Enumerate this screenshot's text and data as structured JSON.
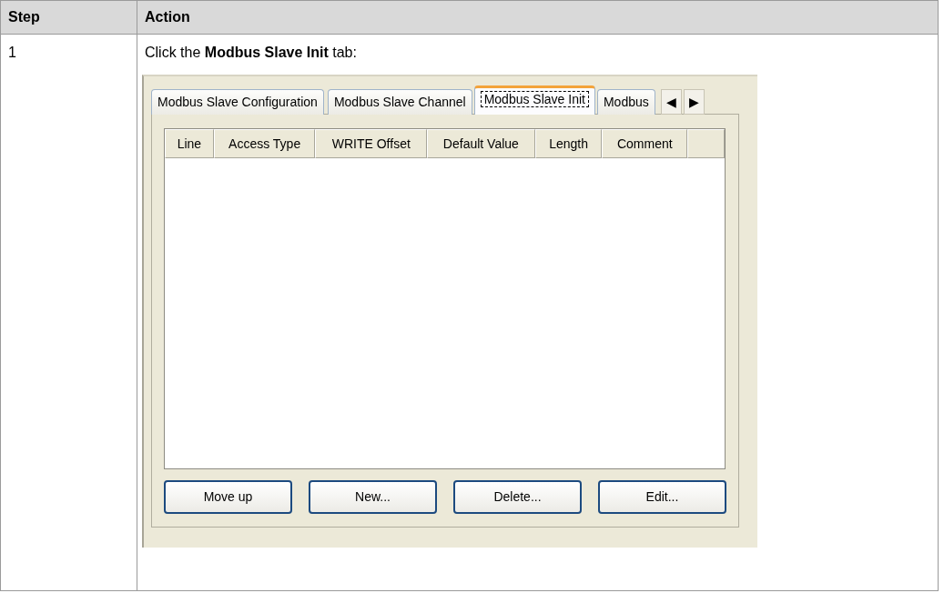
{
  "table": {
    "columns": [
      "Step",
      "Action"
    ],
    "rows": [
      {
        "step": "1",
        "instruction": "Click the **Modbus Slave Init** tab:",
        "screenshot": {
          "tabs": [
            {
              "label": "Modbus Slave Configuration",
              "selected": false
            },
            {
              "label": "Modbus Slave Channel",
              "selected": false
            },
            {
              "label": "Modbus Slave Init",
              "selected": true
            },
            {
              "label": "Modbus",
              "selected": false
            }
          ],
          "scroll_buttons": [
            "◀",
            "▶"
          ],
          "grid": {
            "columns": [
              "Line",
              "Access Type",
              "WRITE Offset",
              "Default Value",
              "Length",
              "Comment"
            ]
          },
          "buttons": [
            "Move up",
            "New...",
            "Delete...",
            "Edit..."
          ]
        }
      }
    ]
  }
}
